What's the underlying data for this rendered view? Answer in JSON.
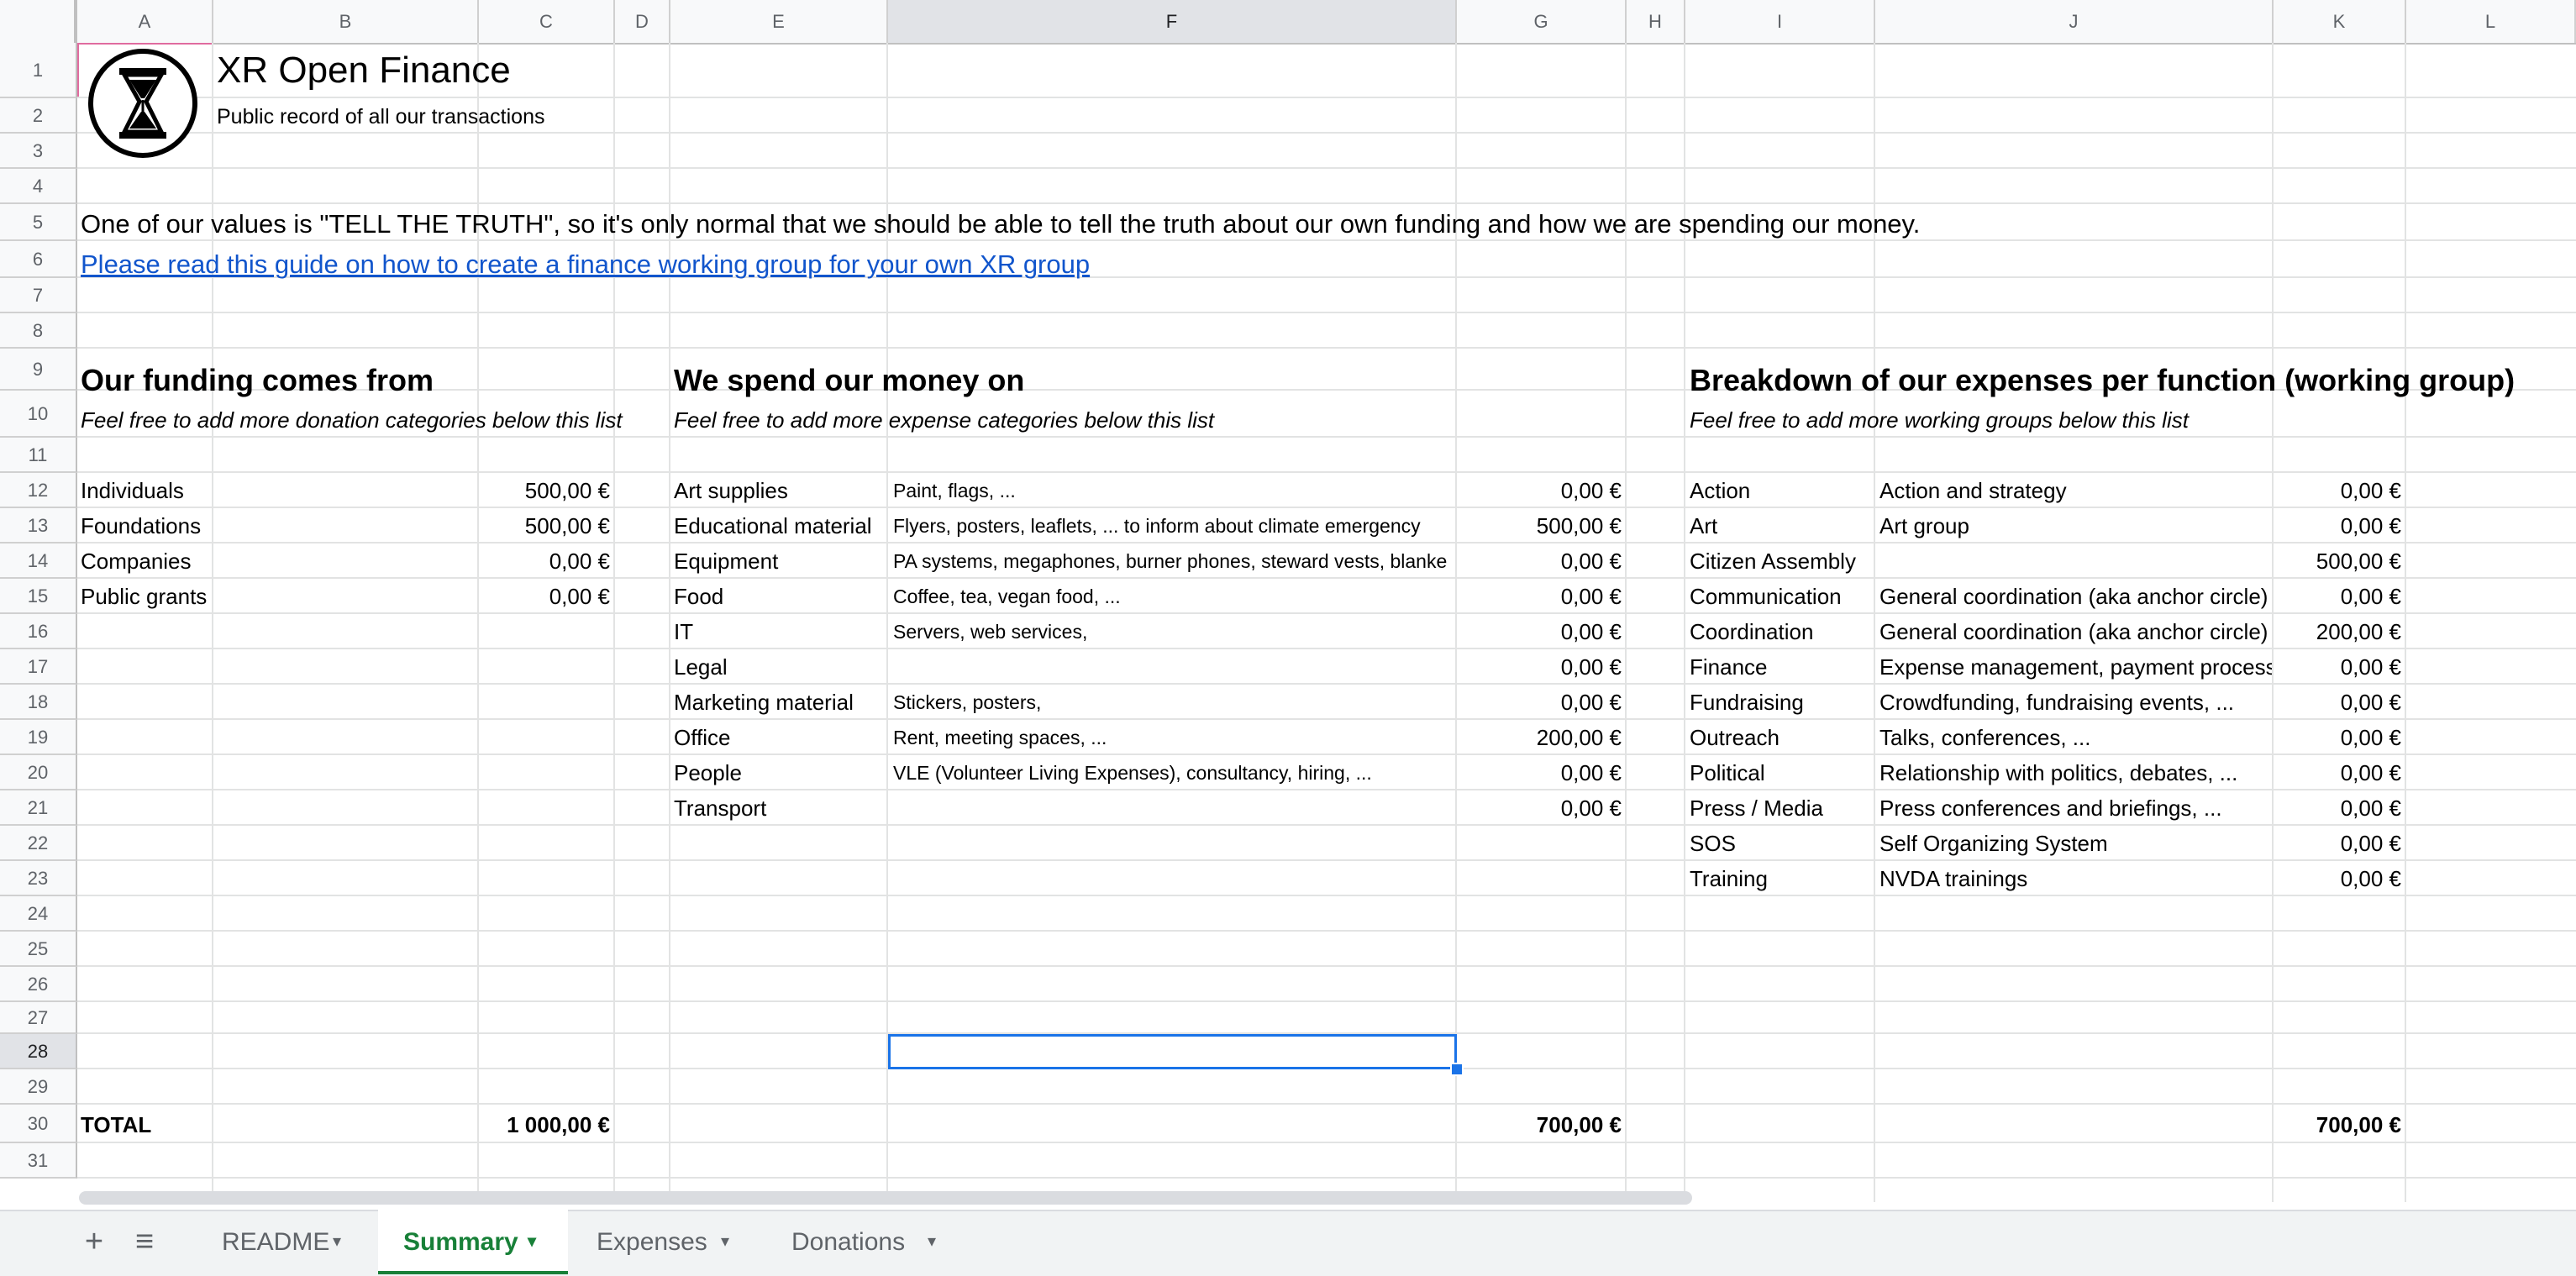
{
  "columns": [
    "A",
    "B",
    "C",
    "D",
    "E",
    "F",
    "G",
    "H",
    "I",
    "J",
    "K",
    "L"
  ],
  "selected_column": "F",
  "rows": [
    "1",
    "2",
    "3",
    "4",
    "5",
    "6",
    "7",
    "8",
    "9",
    "10",
    "11",
    "12",
    "13",
    "14",
    "15",
    "16",
    "17",
    "18",
    "19",
    "20",
    "21",
    "22",
    "23",
    "24",
    "25",
    "26",
    "27",
    "28",
    "29",
    "30",
    "31"
  ],
  "selected_row": "28",
  "header": {
    "title": "XR Open Finance",
    "subtitle": "Public record of all our transactions",
    "values_text": "One of our values is \"TELL THE TRUTH\", so it's only normal that we should be able to tell the truth about our own funding and how we are spending our money.",
    "guide_link": "Please read this guide on how to create a finance working group for your own XR group"
  },
  "logo_icon": "hourglass-logo-icon",
  "funding": {
    "heading": "Our funding comes from",
    "note": "Feel free to add more donation categories below this list",
    "items": [
      {
        "label": "Individuals",
        "amount": "500,00 €"
      },
      {
        "label": "Foundations",
        "amount": "500,00 €"
      },
      {
        "label": "Companies",
        "amount": "0,00 €"
      },
      {
        "label": "Public grants",
        "amount": "0,00 €"
      }
    ],
    "total_label": "TOTAL",
    "total": "1 000,00 €"
  },
  "spending": {
    "heading": "We spend our money on",
    "note": "Feel free to add more expense categories below this list",
    "items": [
      {
        "label": "Art supplies",
        "desc": "Paint, flags, ...",
        "amount": "0,00 €"
      },
      {
        "label": "Educational material",
        "desc": "Flyers, posters, leaflets, ... to inform about climate emergency",
        "amount": "500,00 €"
      },
      {
        "label": "Equipment",
        "desc": "PA systems, megaphones, burner phones, steward vests, blanke",
        "amount": "0,00 €"
      },
      {
        "label": "Food",
        "desc": "Coffee, tea, vegan food, ...",
        "amount": "0,00 €"
      },
      {
        "label": "IT",
        "desc": "Servers, web services,",
        "amount": "0,00 €"
      },
      {
        "label": "Legal",
        "desc": "",
        "amount": "0,00 €"
      },
      {
        "label": "Marketing material",
        "desc": "Stickers, posters,",
        "amount": "0,00 €"
      },
      {
        "label": "Office",
        "desc": "Rent, meeting spaces, ...",
        "amount": "200,00 €"
      },
      {
        "label": "People",
        "desc": "VLE (Volunteer Living Expenses), consultancy, hiring, ...",
        "amount": "0,00 €"
      },
      {
        "label": "Transport",
        "desc": "",
        "amount": "0,00 €"
      }
    ],
    "total": "700,00 €"
  },
  "breakdown": {
    "heading": "Breakdown of our expenses per function (working group)",
    "note": "Feel free to add more working groups below this list",
    "items": [
      {
        "label": "Action",
        "desc": "Action and strategy",
        "amount": "0,00 €"
      },
      {
        "label": "Art",
        "desc": "Art group",
        "amount": "0,00 €"
      },
      {
        "label": "Citizen Assembly",
        "desc": "",
        "amount": "500,00 €"
      },
      {
        "label": "Communication",
        "desc": "General coordination (aka anchor circle)",
        "amount": "0,00 €"
      },
      {
        "label": "Coordination",
        "desc": "General coordination (aka anchor circle)",
        "amount": "200,00 €"
      },
      {
        "label": "Finance",
        "desc": "Expense management, payment process",
        "amount": "0,00 €"
      },
      {
        "label": "Fundraising",
        "desc": "Crowdfunding, fundraising events, ...",
        "amount": "0,00 €"
      },
      {
        "label": "Outreach",
        "desc": "Talks, conferences, ...",
        "amount": "0,00 €"
      },
      {
        "label": "Political",
        "desc": "Relationship with politics, debates, ...",
        "amount": "0,00 €"
      },
      {
        "label": "Press / Media",
        "desc": "Press conferences and briefings, ...",
        "amount": "0,00 €"
      },
      {
        "label": "SOS",
        "desc": "Self Organizing System",
        "amount": "0,00 €"
      },
      {
        "label": "Training",
        "desc": "NVDA trainings",
        "amount": "0,00 €"
      }
    ],
    "total": "700,00 €"
  },
  "sheet_tabs": {
    "add_icon": "+",
    "list_icon": "≡",
    "tabs": [
      {
        "label": "README",
        "active": false
      },
      {
        "label": "Summary",
        "active": true
      },
      {
        "label": "Expenses",
        "active": false
      },
      {
        "label": "Donations",
        "active": false
      }
    ],
    "caret": "▾"
  },
  "colors": {
    "active_tab": "#188038",
    "selection": "#1a73e8",
    "link": "#1155cc"
  }
}
